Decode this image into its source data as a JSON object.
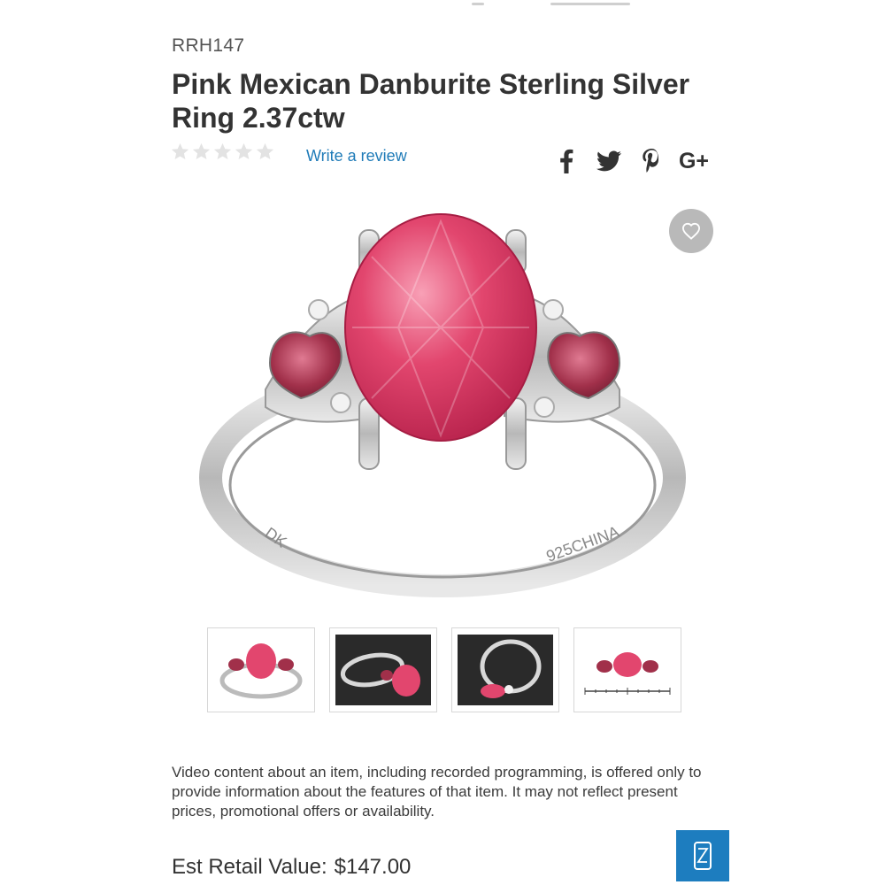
{
  "product": {
    "sku": "RRH147",
    "title": "Pink Mexican Danburite Sterling Silver Ring 2.37ctw",
    "rating_stars": 0,
    "rating_max": 5,
    "review_link": "Write a review"
  },
  "share": {
    "icons": [
      "facebook-icon",
      "twitter-icon",
      "pinterest-icon",
      "google-plus-icon"
    ],
    "google_plus_label": "G+"
  },
  "gallery": {
    "main_image": "ring-photo",
    "ring_inscriptions": [
      "DK",
      "925CHINA"
    ],
    "thumbnails": [
      "front-view",
      "angled-view-dark",
      "side-view-dark",
      "scale-view"
    ]
  },
  "disclaimer": "Video content about an item, including recorded programming, is offered only to provide information about the features of that item. It may not reflect present prices, promotional offers or availability.",
  "pricing": {
    "label": "Est Retail Value:",
    "value": "$147.00"
  },
  "colors": {
    "link": "#1f7bb8",
    "video_button": "#1d7dbf",
    "gem": "#e2466e",
    "side_gem": "#a1304a"
  }
}
